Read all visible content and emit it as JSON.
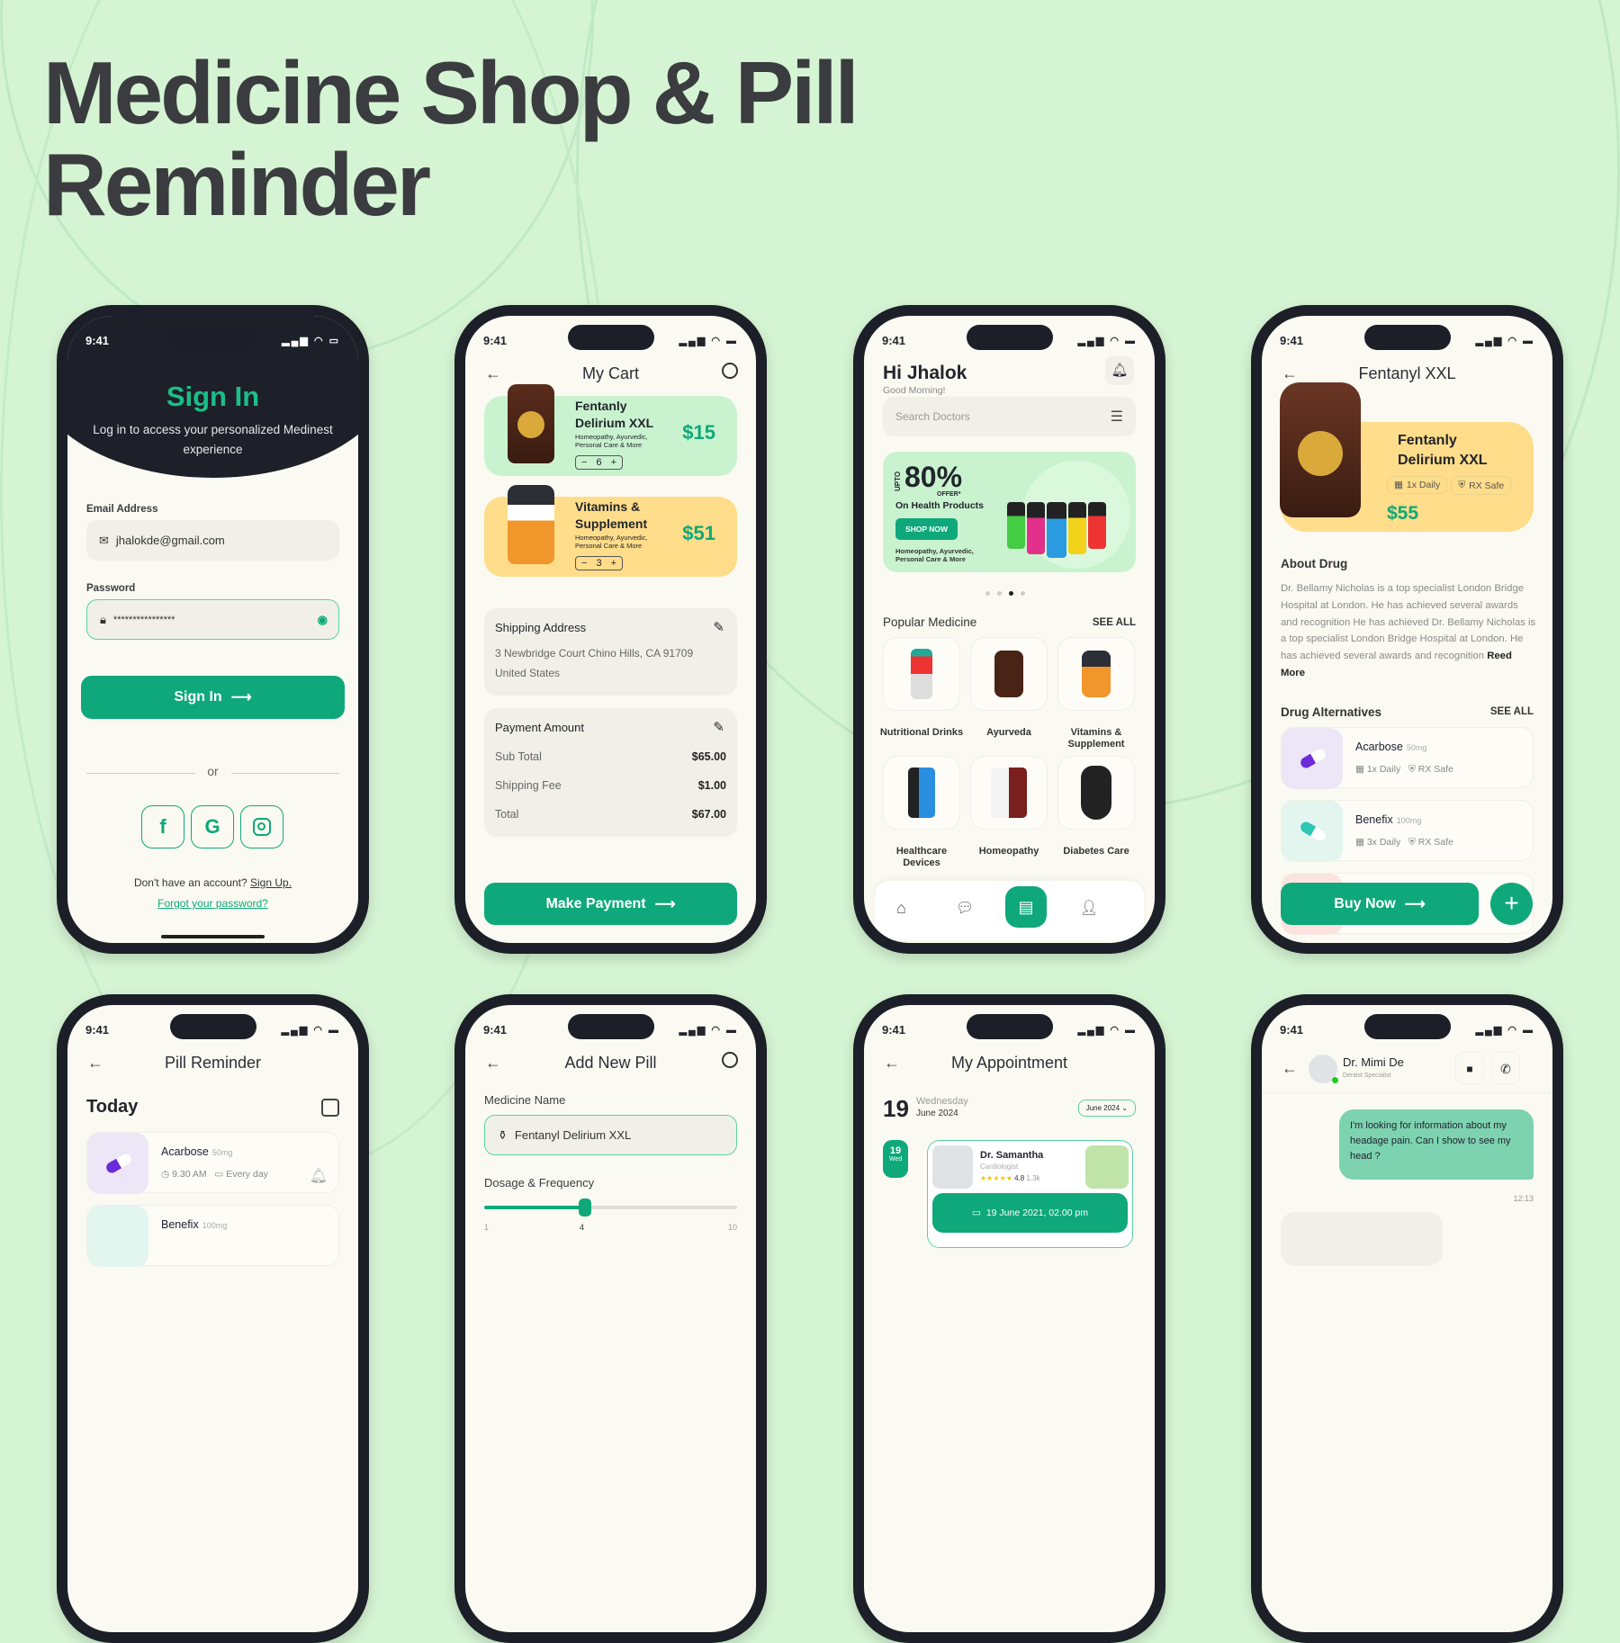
{
  "page": {
    "title_line1": "Medicine Shop & Pill",
    "title_line2": "Reminder",
    "accent": "#0fa87a",
    "dark": "#1c1f27",
    "background": "#d5f4d3"
  },
  "status": {
    "time": "9:41",
    "icons": "signal wifi battery"
  },
  "signin": {
    "title": "Sign In",
    "subtitle": "Log in to access your personalized Medinest experience",
    "email_label": "Email Address",
    "email_value": "jhalokde@gmail.com",
    "password_label": "Password",
    "password_value": "****************",
    "button": "Sign In",
    "or": "or",
    "social": [
      "f",
      "G",
      "instagram"
    ],
    "no_account": "Don't have an account?",
    "sign_up": "Sign Up.",
    "forgot": "Forgot your password?"
  },
  "cart": {
    "title": "My Cart",
    "items": [
      {
        "name": "Fentanly Delirium XXL",
        "desc": "Homeopathy, Ayurvedic, Personal Care & More",
        "qty": "6",
        "price": "$15",
        "color": "#c9f3cf"
      },
      {
        "name": "Vitamins & Supplement",
        "desc": "Homeopathy, Ayurvedic, Personal Care & More",
        "qty": "3",
        "price": "$51",
        "color": "#ffdd8a"
      }
    ],
    "shipping": {
      "title": "Shipping Address",
      "line1": "3 Newbridge Court Chino Hills, CA 91709",
      "line2": "United States"
    },
    "payment": {
      "title": "Payment Amount",
      "rows": [
        {
          "label": "Sub Total",
          "value": "$65.00"
        },
        {
          "label": "Shipping Fee",
          "value": "$1.00"
        },
        {
          "label": "Total",
          "value": "$67.00"
        }
      ]
    },
    "button": "Make Payment"
  },
  "home": {
    "greeting": "Hi Jhalok",
    "sub": "Good Morning!",
    "search_placeholder": "Search Doctors",
    "banner": {
      "upto": "UPTO",
      "percent": "80%",
      "offer": "OFFER*",
      "line": "On Health Products",
      "cta": "SHOP NOW",
      "desc": "Homeopathy, Ayurvedic, Personal Care & More"
    },
    "carousel_active": 3,
    "carousel_count": 4,
    "popular_title": "Popular Medicine",
    "see_all": "SEE ALL",
    "categories": [
      "Nutritional Drinks",
      "Ayurveda",
      "Vitamins & Supplement",
      "Healthcare Devices",
      "Homeopathy",
      "Diabetes Care"
    ],
    "nav": [
      "home",
      "chat",
      "document",
      "profile"
    ],
    "nav_active": "document"
  },
  "detail": {
    "title": "Fentanyl XXL",
    "product": "Fentanly Delirium XXL",
    "chip1": "1x Daily",
    "chip2": "RX Safe",
    "price": "$55",
    "about_title": "About Drug",
    "about": "Dr. Bellamy Nicholas is a top specialist London Bridge Hospital at London. He has achieved several awards and recognition He has achieved Dr. Bellamy Nicholas is a top specialist London Bridge Hospital at London. He has achieved several awards and recognition",
    "read_more": "Reed More",
    "alt_title": "Drug Alternatives",
    "see_all": "SEE ALL",
    "alternatives": [
      {
        "name": "Acarbose",
        "dose": "50mg",
        "freq": "1x Daily",
        "safe": "RX Safe"
      },
      {
        "name": "Benefix",
        "dose": "100mg",
        "freq": "3x Daily",
        "safe": "RX Safe"
      }
    ],
    "button": "Buy Now"
  },
  "reminder": {
    "title": "Pill Reminder",
    "today": "Today",
    "items": [
      {
        "name": "Acarbose",
        "dose": "50mg",
        "time": "9.30 AM",
        "repeat": "Every day"
      },
      {
        "name": "Benefix",
        "dose": "100mg"
      }
    ]
  },
  "addpill": {
    "title": "Add New Pill",
    "name_label": "Medicine Name",
    "name_value": "Fentanyl Delirium XXL",
    "dosage_label": "Dosage & Frequency",
    "slider_value": 4,
    "slider_min": "1",
    "slider_max": "10",
    "slider_mid": "4"
  },
  "appointment": {
    "title": "My Appointment",
    "day": "19",
    "weekday": "Wednesday",
    "month": "June 2024",
    "month_select": "June 2024",
    "marker_day": "19",
    "marker_wd": "Wed",
    "doctor": "Dr. Samantha",
    "specialty": "Cardiologist",
    "rating": "4.8",
    "reviews": "1.3k",
    "slot": "19 June 2021, 02.00 pm"
  },
  "chat": {
    "doctor": "Dr. Mimi De",
    "specialty": "Dentist Specialist",
    "message": "I'm looking for information about my headage pain. Can I show to see my head ?",
    "time": "12:13"
  }
}
